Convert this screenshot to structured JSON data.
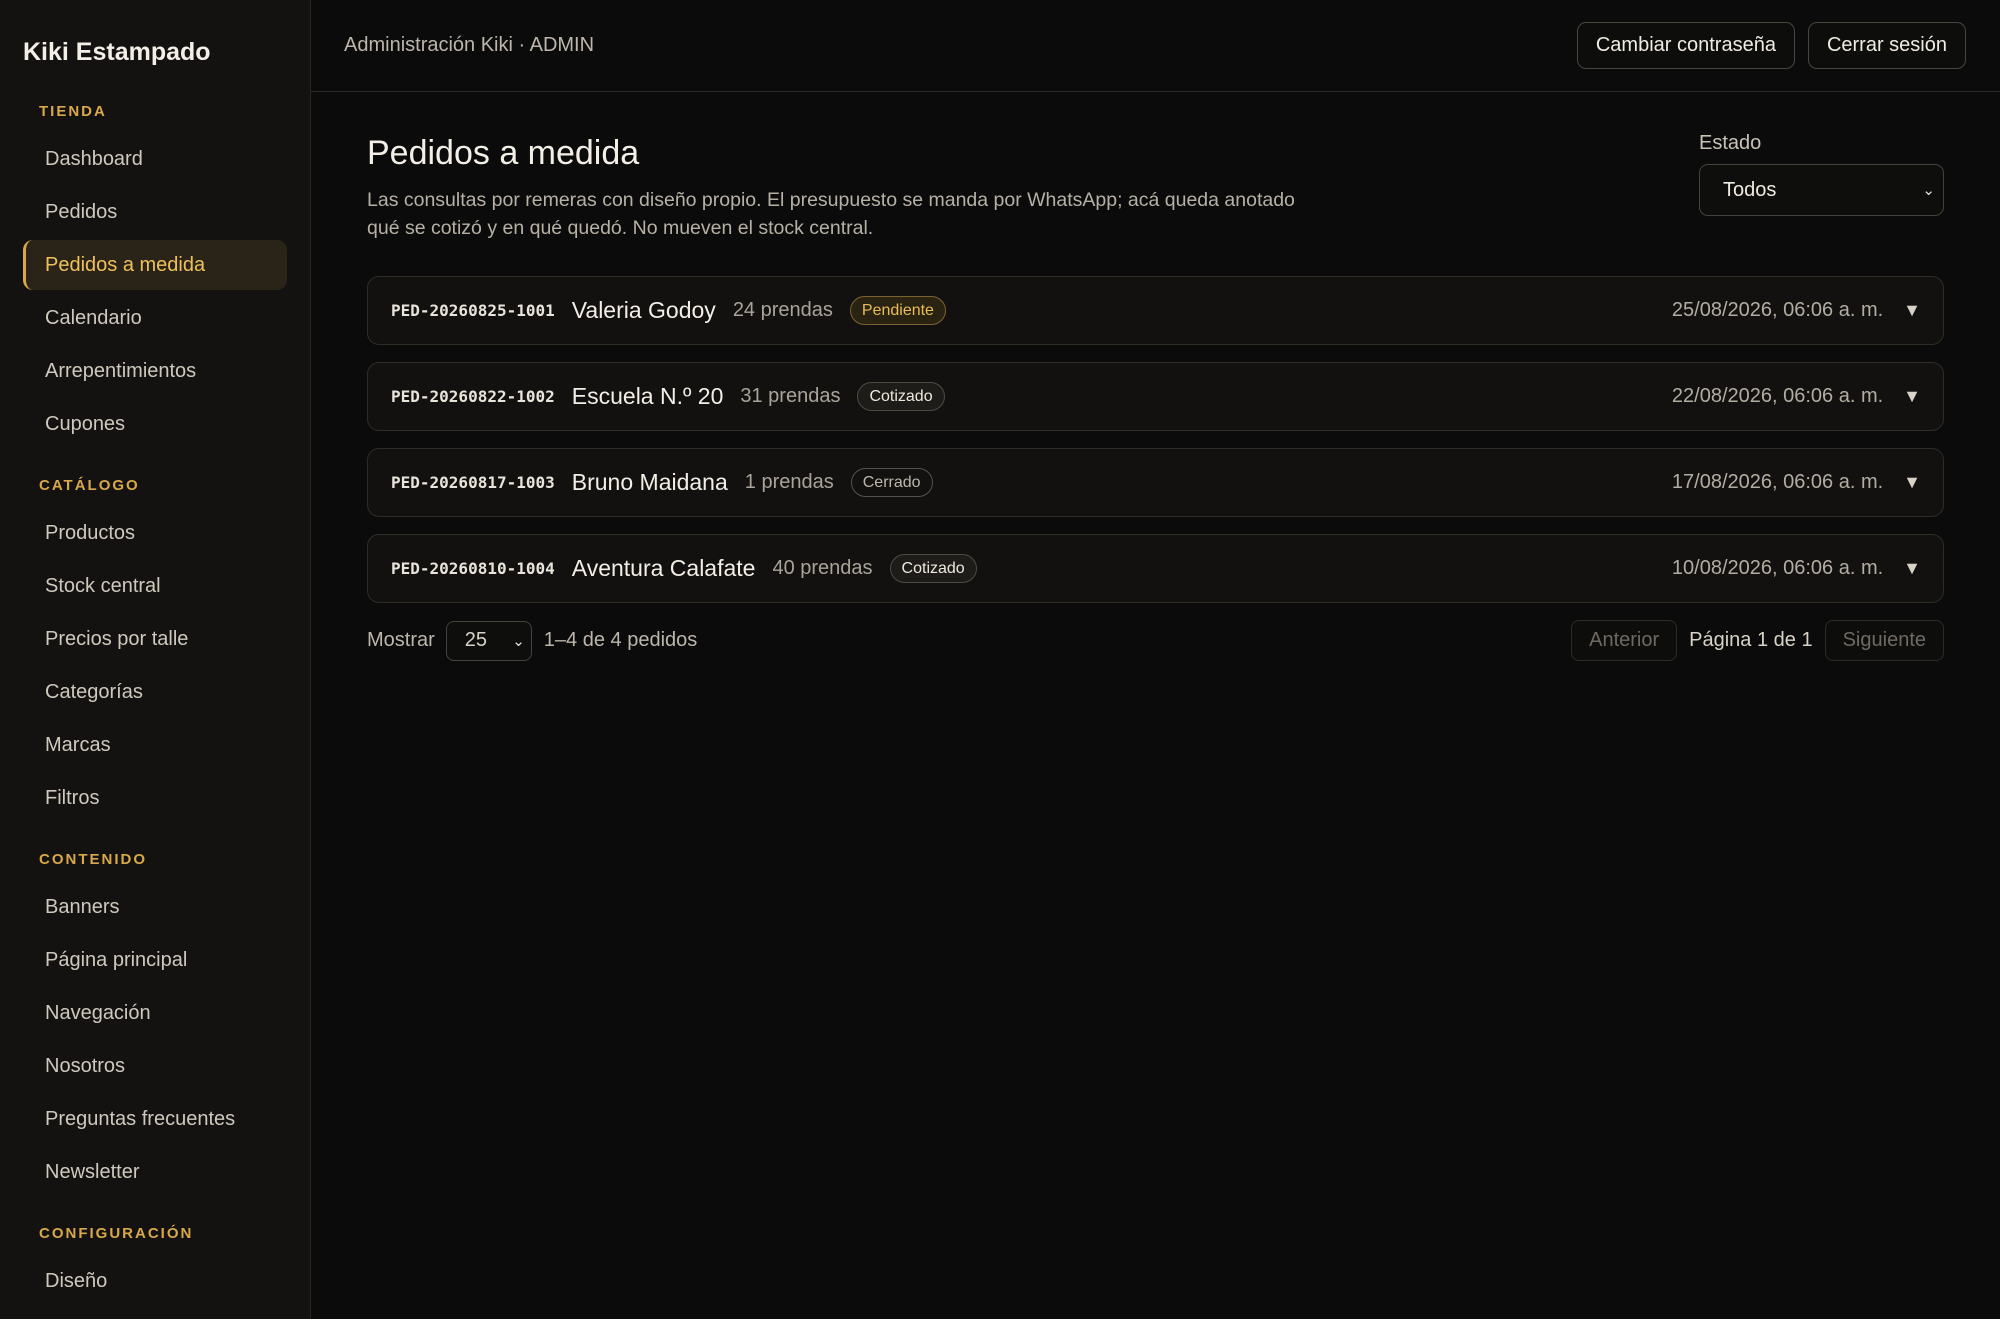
{
  "brand": "Kiki Estampado",
  "sidebar": {
    "sections": [
      {
        "heading": "TIENDA",
        "items": [
          "Dashboard",
          "Pedidos",
          "Pedidos a medida",
          "Calendario",
          "Arrepentimientos",
          "Cupones"
        ]
      },
      {
        "heading": "CATÁLOGO",
        "items": [
          "Productos",
          "Stock central",
          "Precios por talle",
          "Categorías",
          "Marcas",
          "Filtros"
        ]
      },
      {
        "heading": "CONTENIDO",
        "items": [
          "Banners",
          "Página principal",
          "Navegación",
          "Nosotros",
          "Preguntas frecuentes",
          "Newsletter"
        ]
      },
      {
        "heading": "CONFIGURACIÓN",
        "items": [
          "Diseño"
        ]
      }
    ],
    "active_item": "Pedidos a medida"
  },
  "topbar": {
    "title": "Administración Kiki · ADMIN",
    "change_password": "Cambiar contraseña",
    "logout": "Cerrar sesión"
  },
  "page": {
    "title": "Pedidos a medida",
    "description": "Las consultas por remeras con diseño propio. El presupuesto se manda por WhatsApp; acá queda anotado qué se cotizó y en qué quedó. No mueven el stock central.",
    "filter_label": "Estado",
    "filter_value": "Todos"
  },
  "orders": [
    {
      "code": "PED-20260825-1001",
      "name": "Valeria Godoy",
      "qty": "24 prendas",
      "status": "Pendiente",
      "status_kind": "pending",
      "date": "25/08/2026, 06:06 a. m."
    },
    {
      "code": "PED-20260822-1002",
      "name": "Escuela N.º 20",
      "qty": "31 prendas",
      "status": "Cotizado",
      "status_kind": "quoted",
      "date": "22/08/2026, 06:06 a. m."
    },
    {
      "code": "PED-20260817-1003",
      "name": "Bruno Maidana",
      "qty": "1 prendas",
      "status": "Cerrado",
      "status_kind": "closed",
      "date": "17/08/2026, 06:06 a. m."
    },
    {
      "code": "PED-20260810-1004",
      "name": "Aventura Calafate",
      "qty": "40 prendas",
      "status": "Cotizado",
      "status_kind": "quoted",
      "date": "10/08/2026, 06:06 a. m."
    }
  ],
  "pager": {
    "show_label": "Mostrar",
    "per_page": "25",
    "count": "1–4 de 4 pedidos",
    "prev": "Anterior",
    "page_indicator": "Página 1 de 1",
    "next": "Siguiente"
  },
  "icons": {
    "expand": "caret-down-icon",
    "select_chevron": "chevron-down-icon"
  },
  "colors": {
    "accent": "#d8a84a",
    "background": "#0b0b0b",
    "sidebar": "#141210"
  }
}
